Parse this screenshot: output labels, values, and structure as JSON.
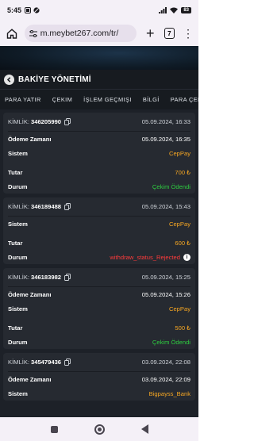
{
  "status": {
    "time": "5:45",
    "battery": "83"
  },
  "browser": {
    "url": "m.meybet267.com/tr/",
    "tab_count": "7",
    "plus": "+",
    "menu": "⋮"
  },
  "page": {
    "title": "BAKİYE YÖNETİMİ",
    "tabs": [
      "PARA YATIR",
      "ÇEKIM",
      "İŞLEM GEÇMIŞI",
      "BİLGİ",
      "PARA ÇEKME DURUMU"
    ]
  },
  "transactions": [
    {
      "id_label": "KİMLİK:",
      "id": "346205990",
      "date": "05.09.2024, 16:33",
      "rows": [
        {
          "label": "Ödeme Zamanı",
          "value": "05.09.2024, 16:35",
          "color": "white"
        },
        {
          "label": "Sistem",
          "value": "CepPay",
          "color": "orange"
        },
        {
          "gap": true
        },
        {
          "label": "Tutar",
          "value": "700 ₺",
          "color": "orange"
        },
        {
          "label": "Durum",
          "value": "Çekim Ödendi",
          "color": "green"
        }
      ]
    },
    {
      "id_label": "KİMLİK:",
      "id": "346189488",
      "date": "05.09.2024, 15:43",
      "rows": [
        {
          "label": "Sistem",
          "value": "CepPay",
          "color": "orange"
        },
        {
          "gap": true
        },
        {
          "label": "Tutar",
          "value": "600 ₺",
          "color": "orange"
        },
        {
          "label": "Durum",
          "value": "withdraw_status_Rejected",
          "color": "red",
          "info": true
        }
      ]
    },
    {
      "id_label": "KİMLİK:",
      "id": "346183982",
      "date": "05.09.2024, 15:25",
      "rows": [
        {
          "label": "Ödeme Zamanı",
          "value": "05.09.2024, 15:26",
          "color": "white"
        },
        {
          "label": "Sistem",
          "value": "CepPay",
          "color": "orange"
        },
        {
          "gap": true
        },
        {
          "label": "Tutar",
          "value": "500 ₺",
          "color": "orange"
        },
        {
          "label": "Durum",
          "value": "Çekim Ödendi",
          "color": "green"
        }
      ]
    },
    {
      "id_label": "KİMLİK:",
      "id": "345479436",
      "date": "03.09.2024, 22:08",
      "rows": [
        {
          "label": "Ödeme Zamanı",
          "value": "03.09.2024, 22:09",
          "color": "white"
        },
        {
          "label": "Sistem",
          "value": "Bigpayss_Bank",
          "color": "orange"
        }
      ]
    }
  ],
  "colors": {
    "background": "#1d2128",
    "card": "#262a31",
    "orange": "#f5a623",
    "green": "#2ecc40",
    "red": "#ff3b3b"
  }
}
